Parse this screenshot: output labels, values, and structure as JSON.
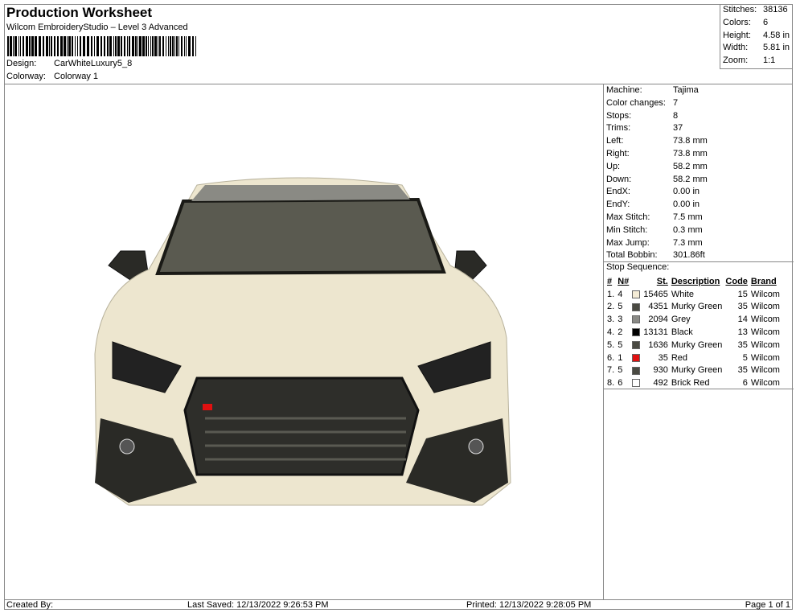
{
  "header": {
    "title": "Production Worksheet",
    "subtitle": "Wilcom EmbroideryStudio – Level 3 Advanced",
    "design_label": "Design:",
    "design": "CarWhiteLuxury5_8",
    "colorway_label": "Colorway:",
    "colorway": "Colorway 1"
  },
  "summary": [
    {
      "k": "Stitches:",
      "v": "38136"
    },
    {
      "k": "Colors:",
      "v": "6"
    },
    {
      "k": "Height:",
      "v": "4.58 in"
    },
    {
      "k": "Width:",
      "v": "5.81 in"
    },
    {
      "k": "Zoom:",
      "v": "1:1"
    }
  ],
  "machine": [
    {
      "k": "Machine:",
      "v": "Tajima"
    },
    {
      "k": "Color changes:",
      "v": "7"
    },
    {
      "k": "Stops:",
      "v": "8"
    },
    {
      "k": "Trims:",
      "v": "37"
    },
    {
      "k": "Left:",
      "v": "73.8 mm"
    },
    {
      "k": "Right:",
      "v": "73.8 mm"
    },
    {
      "k": "Up:",
      "v": "58.2 mm"
    },
    {
      "k": "Down:",
      "v": "58.2 mm"
    },
    {
      "k": "EndX:",
      "v": "0.00 in"
    },
    {
      "k": "EndY:",
      "v": "0.00 in"
    },
    {
      "k": "Max Stitch:",
      "v": "7.5 mm"
    },
    {
      "k": "Min Stitch:",
      "v": "0.3 mm"
    },
    {
      "k": "Max Jump:",
      "v": "7.3 mm"
    },
    {
      "k": "Total Bobbin:",
      "v": "301.86ft"
    }
  ],
  "stop_sequence": {
    "label": "Stop Sequence:",
    "columns": [
      "#",
      "N#",
      "St.",
      "Description",
      "Code",
      "Brand"
    ],
    "rows": [
      {
        "i": "1.",
        "n": "4",
        "color": "#f5ecd6",
        "st": "15465",
        "desc": "White",
        "code": "15",
        "brand": "Wilcom"
      },
      {
        "i": "2.",
        "n": "5",
        "color": "#4a4a42",
        "st": "4351",
        "desc": "Murky Green",
        "code": "35",
        "brand": "Wilcom"
      },
      {
        "i": "3.",
        "n": "3",
        "color": "#8a8a86",
        "st": "2094",
        "desc": "Grey",
        "code": "14",
        "brand": "Wilcom"
      },
      {
        "i": "4.",
        "n": "2",
        "color": "#000000",
        "st": "13131",
        "desc": "Black",
        "code": "13",
        "brand": "Wilcom"
      },
      {
        "i": "5.",
        "n": "5",
        "color": "#4a4a42",
        "st": "1636",
        "desc": "Murky Green",
        "code": "35",
        "brand": "Wilcom"
      },
      {
        "i": "6.",
        "n": "1",
        "color": "#e01010",
        "st": "35",
        "desc": "Red",
        "code": "5",
        "brand": "Wilcom"
      },
      {
        "i": "7.",
        "n": "5",
        "color": "#4a4a42",
        "st": "930",
        "desc": "Murky Green",
        "code": "35",
        "brand": "Wilcom"
      },
      {
        "i": "8.",
        "n": "6",
        "color": "#ffffff",
        "st": "492",
        "desc": "Brick Red",
        "code": "6",
        "brand": "Wilcom"
      }
    ]
  },
  "footer": {
    "created": "Created By:",
    "saved": "Last Saved: 12/13/2022 9:26:53 PM",
    "printed": "Printed: 12/13/2022 9:28:05 PM",
    "page": "Page 1 of 1"
  }
}
